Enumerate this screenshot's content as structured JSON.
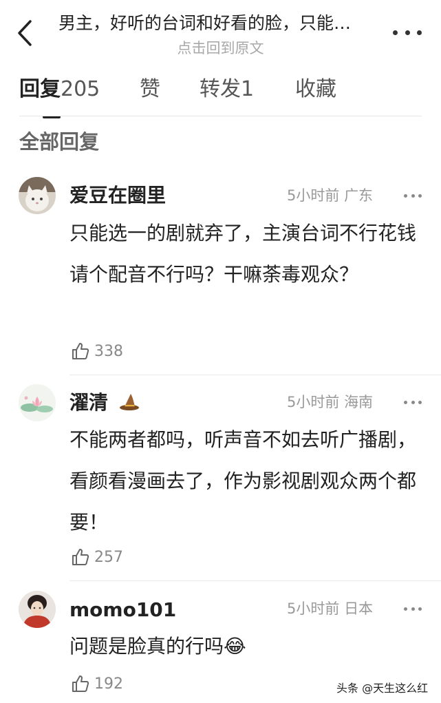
{
  "header": {
    "title": "男主，好听的台词和好看的脸，只能…",
    "subtitle": "点击回到原文"
  },
  "tabs": [
    {
      "label": "回复",
      "count": "205"
    },
    {
      "label": "赞"
    },
    {
      "label": "转发",
      "count": "1"
    },
    {
      "label": "收藏"
    }
  ],
  "section_title": "全部回复",
  "comments": [
    {
      "username": "爱豆在圈里",
      "time": "5小时前",
      "location": "广东",
      "text": "只能选一的剧就弃了，主演台词不行花钱请个配音不行吗？干嘛荼毒观众？",
      "likes": "338",
      "avatar": "cat-avatar"
    },
    {
      "username": "濯清",
      "badge": "wizard-hat-icon",
      "time": "5小时前",
      "location": "海南",
      "text": "不能两者都吗，听声音不如去听广播剧，看颜看漫画去了，作为影视剧观众两个都要！",
      "likes": "257",
      "avatar": "lotus-avatar"
    },
    {
      "username": "momo101",
      "time": "5小时前",
      "location": "日本",
      "text": "问题是脸真的行吗",
      "emoji": "😂",
      "likes": "192",
      "avatar": "woman-avatar"
    }
  ],
  "watermark": "头条 @天生这么红",
  "colors": {
    "text": "#222222",
    "secondary": "#999999",
    "divider": "#e8e8e8"
  }
}
